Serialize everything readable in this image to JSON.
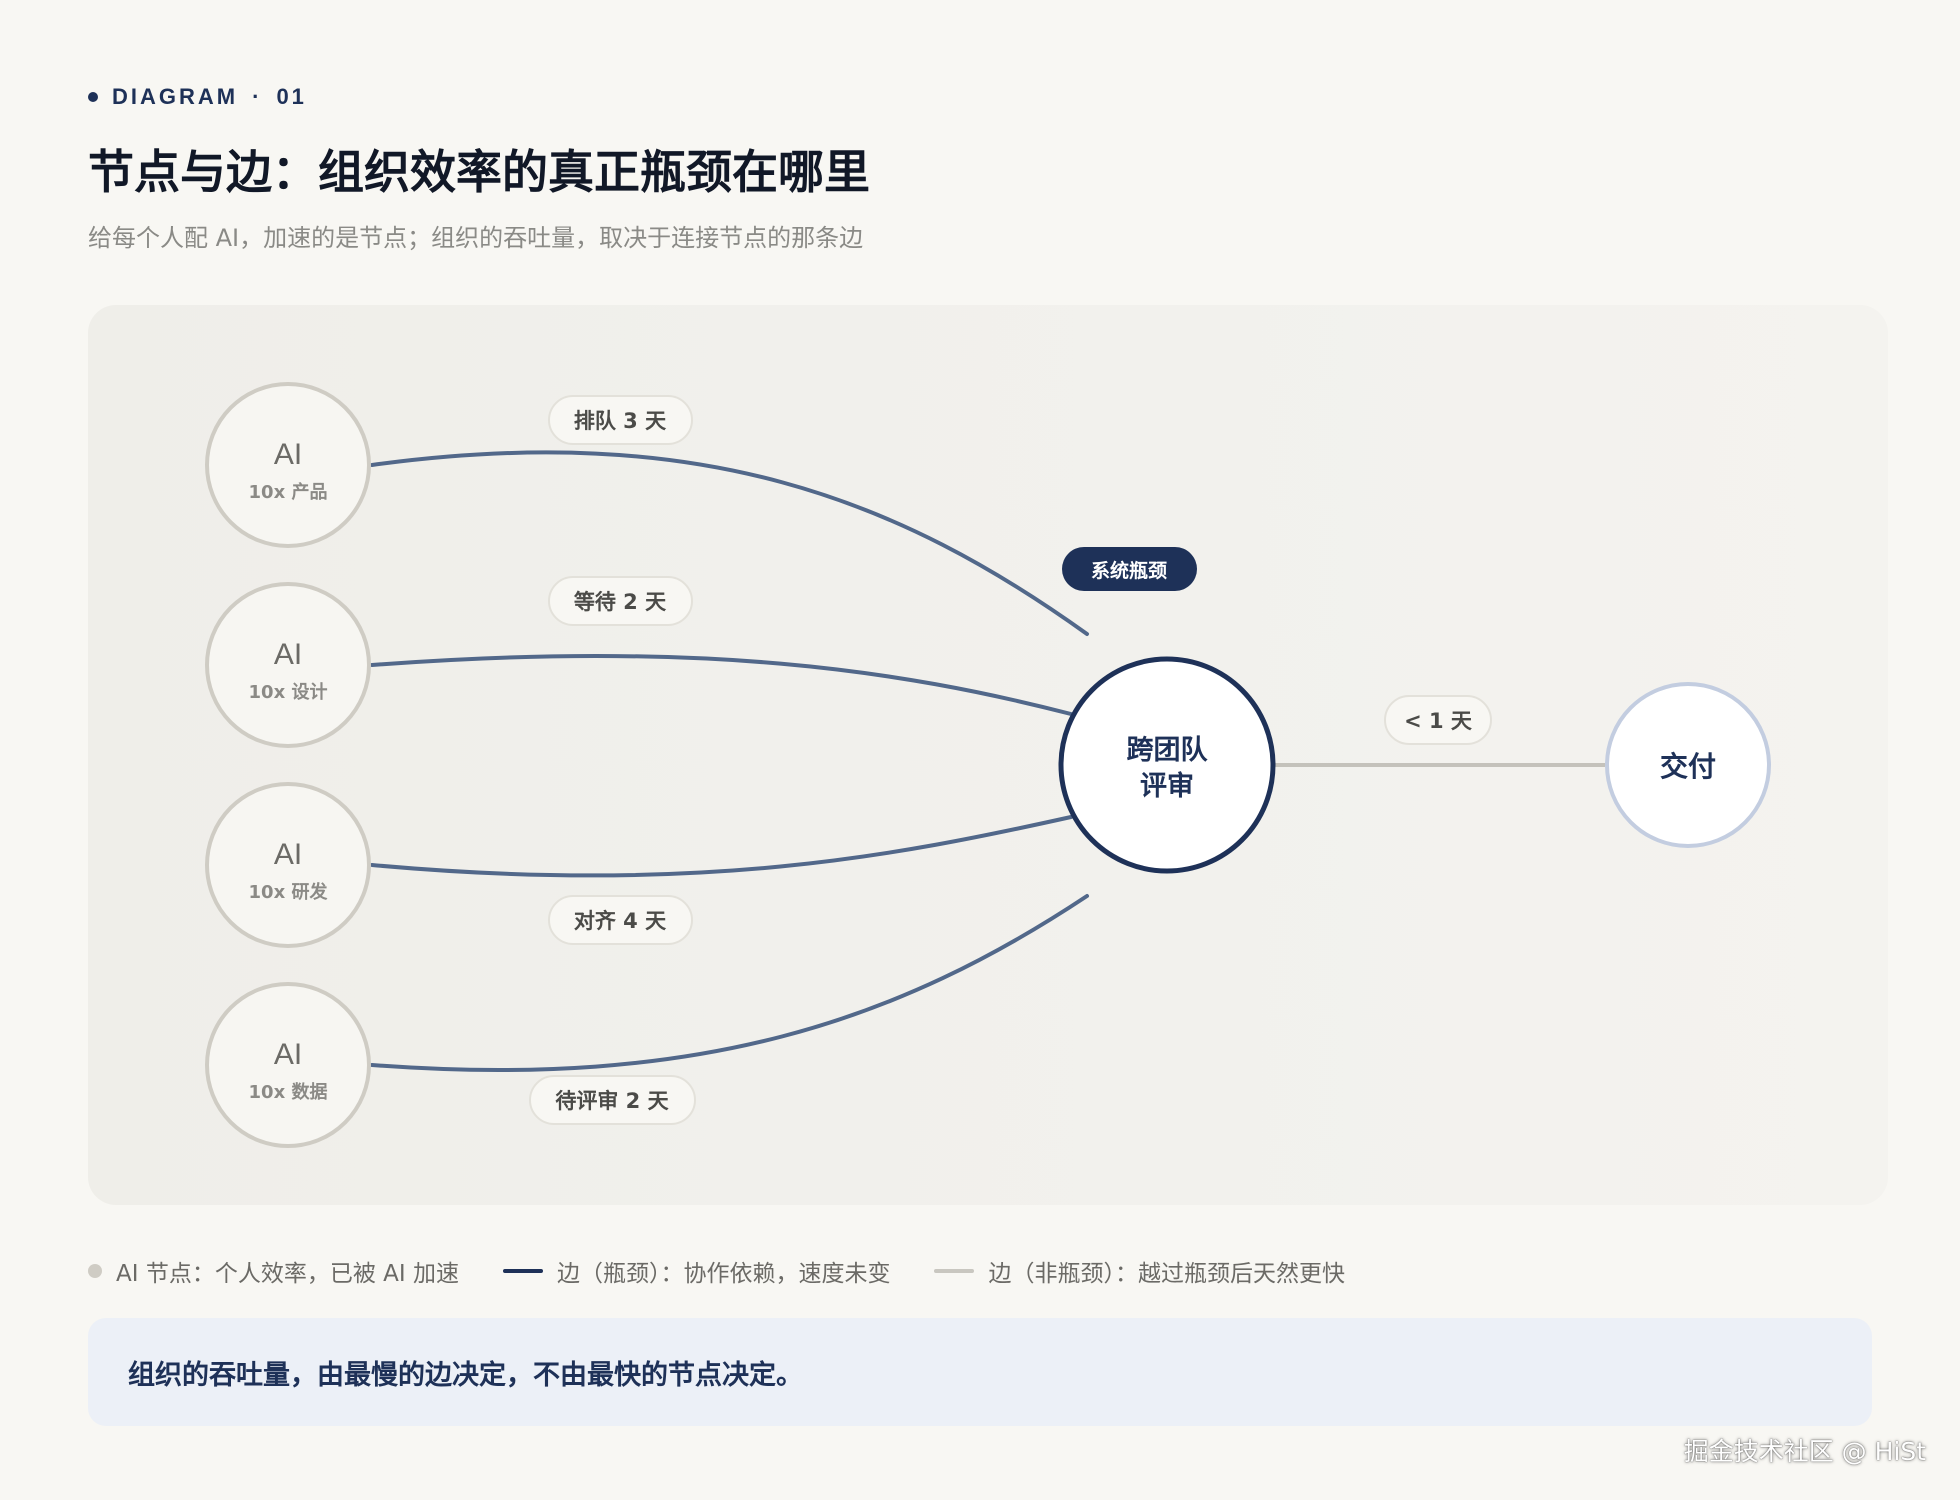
{
  "header": {
    "eyebrow_label": "DIAGRAM",
    "eyebrow_sep": "·",
    "eyebrow_num": "01",
    "title": "节点与边：组织效率的真正瓶颈在哪里",
    "subtitle": "给每个人配 AI，加速的是节点；组织的吞吐量，取决于连接节点的那条边"
  },
  "diagram": {
    "ai_nodes": [
      {
        "title": "AI",
        "subtitle": "10x 产品"
      },
      {
        "title": "AI",
        "subtitle": "10x 设计"
      },
      {
        "title": "AI",
        "subtitle": "10x 研发"
      },
      {
        "title": "AI",
        "subtitle": "10x 数据"
      }
    ],
    "edge_labels": [
      "排队 3 天",
      "等待 2 天",
      "对齐 4 天",
      "待评审 2 天"
    ],
    "hub": {
      "line1": "跨团队",
      "line2": "评审"
    },
    "bottleneck_badge": "系统瓶颈",
    "output_edge_label": "< 1 天",
    "destination": "交付",
    "colors": {
      "bottleneck_edge": "#52688a",
      "fast_edge": "#c4c2bb",
      "hub_ring": "#1e3158",
      "ai_ring": "#cfccc4",
      "dest_ring": "#c3cde0",
      "badge_bg": "#1e3158"
    }
  },
  "legend": {
    "ai_node": "AI 节点：个人效率，已被 AI 加速",
    "bottleneck_edge": "边（瓶颈）：协作依赖，速度未变",
    "fast_edge": "边（非瓶颈）：越过瓶颈后天然更快"
  },
  "callout": "组织的吞吐量，由最慢的边决定，不由最快的节点决定。",
  "watermark": "掘金技术社区 @ HiSt"
}
